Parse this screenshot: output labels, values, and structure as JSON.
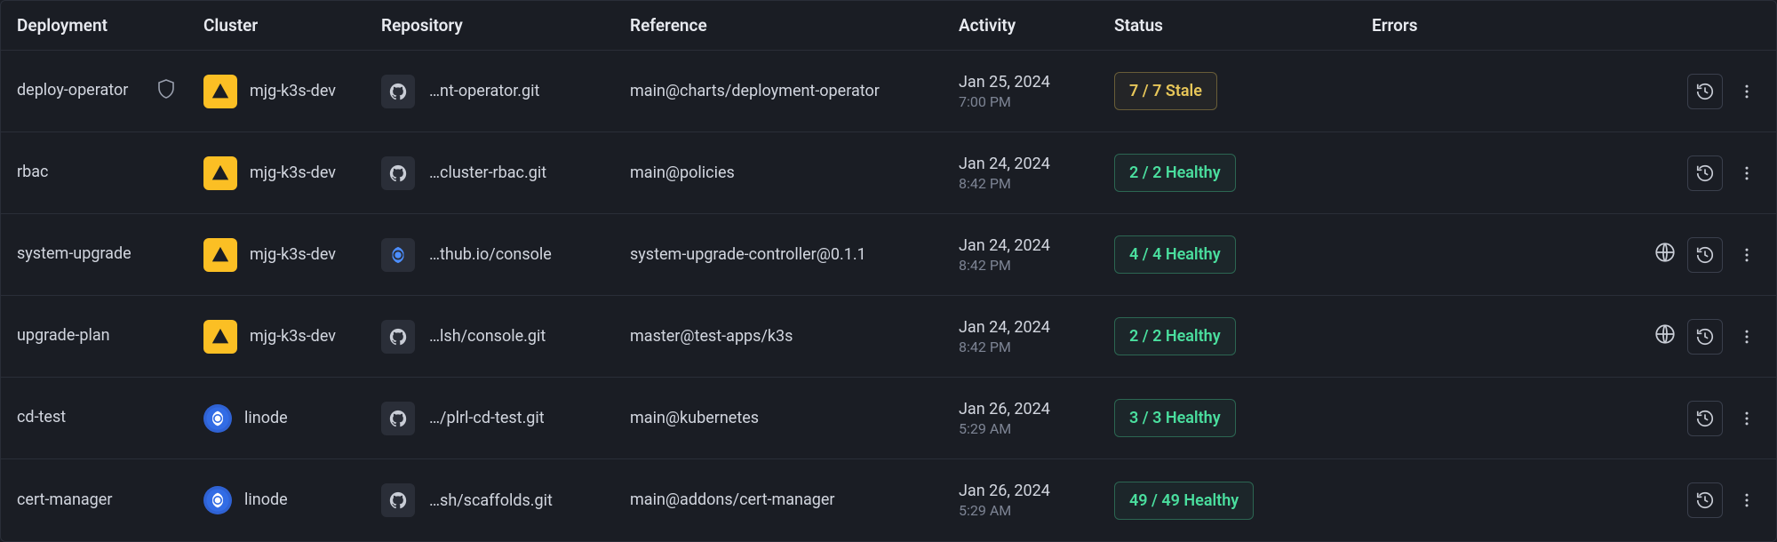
{
  "headers": {
    "deployment": "Deployment",
    "cluster": "Cluster",
    "repository": "Repository",
    "reference": "Reference",
    "activity": "Activity",
    "status": "Status",
    "errors": "Errors"
  },
  "rows": [
    {
      "deployment": "deploy-operator",
      "has_shield": true,
      "cluster_icon": "warn",
      "cluster": "mjg-k3s-dev",
      "repo_icon": "github",
      "repository": "…nt-operator.git",
      "reference": "main@charts/deployment-operator",
      "activity_date": "Jan 25, 2024",
      "activity_time": "7:00 PM",
      "status_text": "7 / 7 Stale",
      "status_kind": "stale",
      "has_globe": false
    },
    {
      "deployment": "rbac",
      "has_shield": false,
      "cluster_icon": "warn",
      "cluster": "mjg-k3s-dev",
      "repo_icon": "github",
      "repository": "…cluster-rbac.git",
      "reference": "main@policies",
      "activity_date": "Jan 24, 2024",
      "activity_time": "8:42 PM",
      "status_text": "2 / 2 Healthy",
      "status_kind": "healthy",
      "has_globe": false
    },
    {
      "deployment": "system-upgrade",
      "has_shield": false,
      "cluster_icon": "warn",
      "cluster": "mjg-k3s-dev",
      "repo_icon": "helm",
      "repository": "…thub.io/console",
      "reference": "system-upgrade-controller@0.1.1",
      "activity_date": "Jan 24, 2024",
      "activity_time": "8:42 PM",
      "status_text": "4 / 4 Healthy",
      "status_kind": "healthy",
      "has_globe": true
    },
    {
      "deployment": "upgrade-plan",
      "has_shield": false,
      "cluster_icon": "warn",
      "cluster": "mjg-k3s-dev",
      "repo_icon": "github",
      "repository": "…lsh/console.git",
      "reference": "master@test-apps/k3s",
      "activity_date": "Jan 24, 2024",
      "activity_time": "8:42 PM",
      "status_text": "2 / 2 Healthy",
      "status_kind": "healthy",
      "has_globe": true
    },
    {
      "deployment": "cd-test",
      "has_shield": false,
      "cluster_icon": "k8s",
      "cluster": "linode",
      "repo_icon": "github",
      "repository": "…/plrl-cd-test.git",
      "reference": "main@kubernetes",
      "activity_date": "Jan 26, 2024",
      "activity_time": "5:29 AM",
      "status_text": "3 / 3 Healthy",
      "status_kind": "healthy",
      "has_globe": false
    },
    {
      "deployment": "cert-manager",
      "has_shield": false,
      "cluster_icon": "k8s",
      "cluster": "linode",
      "repo_icon": "github",
      "repository": "…sh/scaffolds.git",
      "reference": "main@addons/cert-manager",
      "activity_date": "Jan 26, 2024",
      "activity_time": "5:29 AM",
      "status_text": "49 / 49 Healthy",
      "status_kind": "healthy",
      "has_globe": false
    }
  ]
}
